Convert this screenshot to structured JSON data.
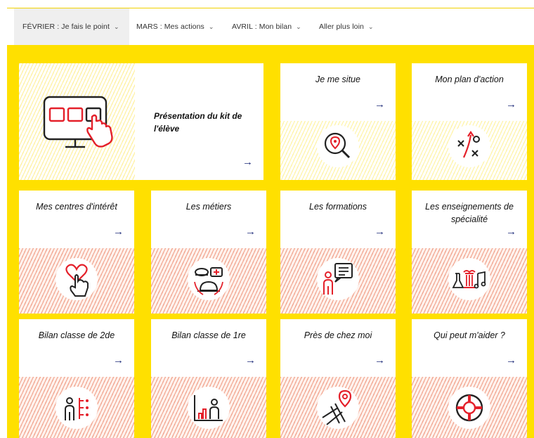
{
  "nav": {
    "items": [
      {
        "label": "FÉVRIER : Je fais le point"
      },
      {
        "label": "MARS : Mes actions"
      },
      {
        "label": "AVRIL : Mon bilan"
      },
      {
        "label": "Aller plus loin"
      }
    ],
    "chevron": "⌄"
  },
  "cards": {
    "kit": {
      "title": "Présentation du kit de l'élève",
      "icon": "screen-touch-icon"
    },
    "je_me_situe": {
      "title": "Je me situe",
      "icon": "search-location-icon"
    },
    "plan_action": {
      "title": "Mon plan d'action",
      "icon": "strategy-icon"
    },
    "centres_interet": {
      "title": "Mes centres d'intérêt",
      "icon": "heart-hand-icon"
    },
    "metiers": {
      "title": "Les métiers",
      "icon": "professions-icon"
    },
    "formations": {
      "title": "Les formations",
      "icon": "speech-person-icon"
    },
    "enseignements": {
      "title": "Les enseignements de spécialité",
      "icon": "specialties-icon"
    },
    "bilan_2de": {
      "title": "Bilan classe de 2de",
      "icon": "person-checklist-icon"
    },
    "bilan_1re": {
      "title": "Bilan classe de 1re",
      "icon": "chart-person-icon"
    },
    "pres_de_chez_moi": {
      "title": "Près de chez moi",
      "icon": "map-pin-icon"
    },
    "qui_peut_aider": {
      "title": "Qui peut m'aider ?",
      "icon": "lifebuoy-icon"
    }
  },
  "arrow": "→",
  "colors": {
    "brand_yellow": "#ffe000",
    "accent_red": "#e4202a",
    "arrow_blue": "#1c2a78"
  }
}
